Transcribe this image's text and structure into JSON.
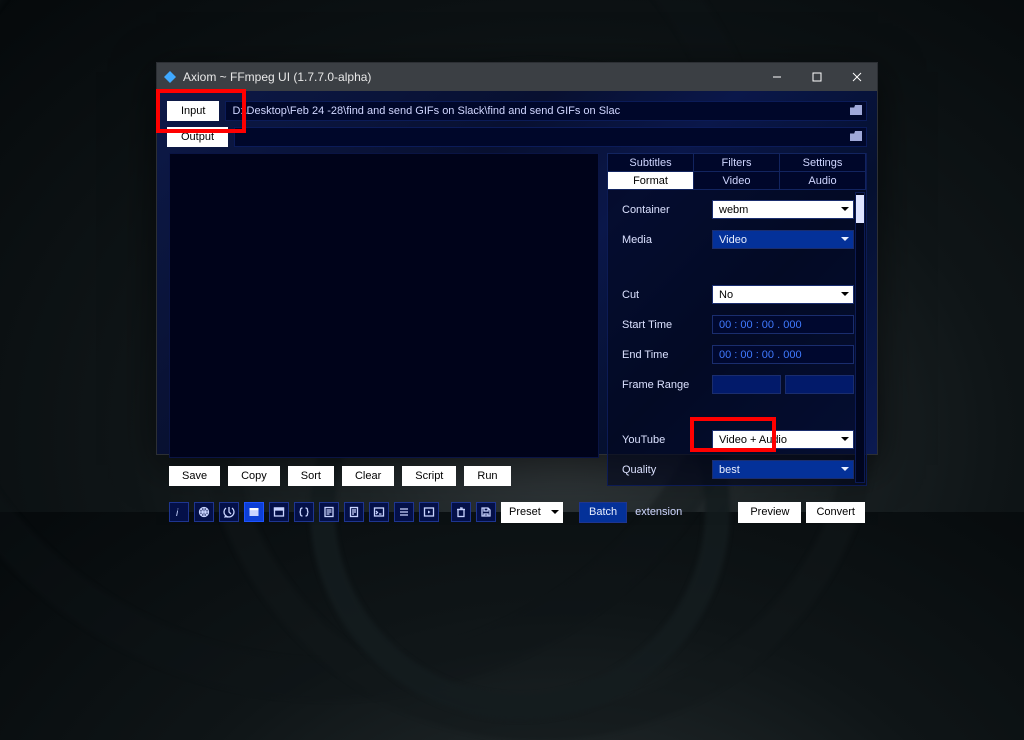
{
  "window": {
    "title": "Axiom ~ FFmpeg UI (1.7.7.0-alpha)"
  },
  "io": {
    "input_label": "Input",
    "output_label": "Output",
    "input_path": "D:\\Desktop\\Feb 24 -28\\find and send GIFs on Slack\\find and send GIFs on Slac",
    "output_path": ""
  },
  "actions": {
    "save": "Save",
    "copy": "Copy",
    "sort": "Sort",
    "clear": "Clear",
    "script": "Script",
    "run": "Run"
  },
  "tabs": {
    "row1": [
      "Subtitles",
      "Filters",
      "Settings"
    ],
    "row2": [
      "Format",
      "Video",
      "Audio"
    ],
    "active": "Format"
  },
  "format": {
    "container_label": "Container",
    "container_value": "webm",
    "media_label": "Media",
    "media_value": "Video",
    "cut_label": "Cut",
    "cut_value": "No",
    "start_label": "Start Time",
    "start_value": "00 : 00 : 00 . 000",
    "end_label": "End Time",
    "end_value": "00 : 00 : 00 . 000",
    "framerange_label": "Frame Range",
    "youtube_label": "YouTube",
    "youtube_value": "Video + Audio",
    "quality_label": "Quality",
    "quality_value": "best"
  },
  "bottom": {
    "preset": "Preset",
    "batch": "Batch",
    "extension": "extension",
    "preview": "Preview",
    "convert": "Convert"
  }
}
